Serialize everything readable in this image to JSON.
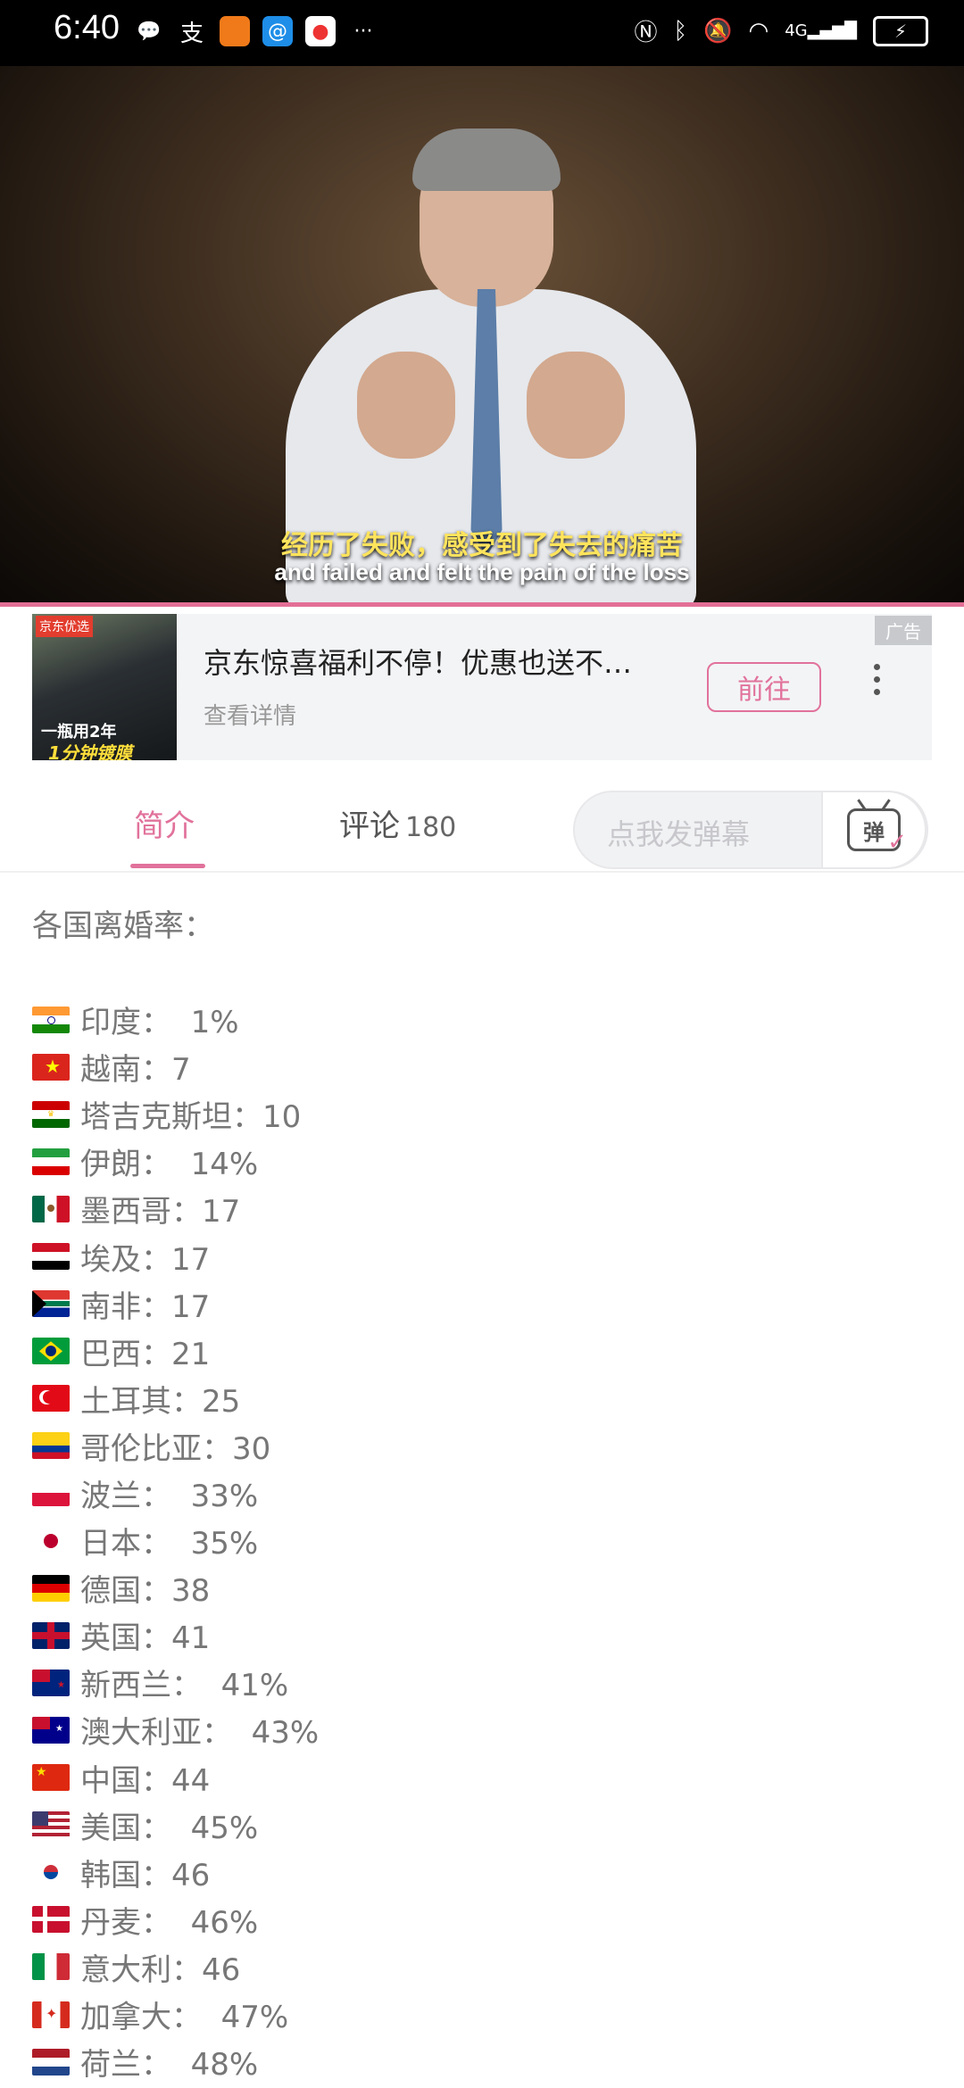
{
  "status_bar": {
    "time": "6:40",
    "left_icons": [
      "chat-bubble-icon",
      "alipay-icon",
      "app-orange-icon",
      "app-blue-icon",
      "app-red-icon",
      "more-dots-icon"
    ],
    "right_icons": [
      "nfc-icon",
      "bluetooth-icon",
      "mute-bell-icon",
      "wifi-icon",
      "signal-4g-icon",
      "battery-charging-icon"
    ],
    "network": "4G"
  },
  "video": {
    "subtitle_cn": "经历了失败，感受到了失去的痛苦",
    "subtitle_en": "and failed and felt the pain of the loss",
    "accent_color": "#e36f96"
  },
  "ad": {
    "thumb_tag": "京东优选",
    "thumb_line1": "一瓶用2年",
    "thumb_line2": "1分钟镀膜",
    "title": "京东惊喜福利不停！优惠也送不…",
    "subtitle": "查看详情",
    "button_label": "前往",
    "tag": "广告"
  },
  "tabs": {
    "intro_label": "简介",
    "comments_label": "评论",
    "comments_count": "180",
    "danmaku_placeholder": "点我发弹幕",
    "danmaku_icon": "弹"
  },
  "description": {
    "heading": "各国离婚率：",
    "rows": [
      {
        "flag": "india",
        "text": "印度：  1%"
      },
      {
        "flag": "vietnam",
        "text": "越南：7"
      },
      {
        "flag": "tajikistan",
        "text": "塔吉克斯坦：10"
      },
      {
        "flag": "iran",
        "text": "伊朗：  14%"
      },
      {
        "flag": "mexico",
        "text": "墨西哥：17"
      },
      {
        "flag": "egypt",
        "text": "埃及：17"
      },
      {
        "flag": "south-africa",
        "text": "南非：17"
      },
      {
        "flag": "brazil",
        "text": "巴西：21"
      },
      {
        "flag": "turkey",
        "text": "土耳其：25"
      },
      {
        "flag": "colombia",
        "text": "哥伦比亚：30"
      },
      {
        "flag": "poland",
        "text": "波兰：  33%"
      },
      {
        "flag": "japan",
        "text": "日本：  35%"
      },
      {
        "flag": "germany",
        "text": "德国：38"
      },
      {
        "flag": "uk",
        "text": "英国：41"
      },
      {
        "flag": "new-zealand",
        "text": "新西兰：  41%"
      },
      {
        "flag": "australia",
        "text": "澳大利亚：  43%"
      },
      {
        "flag": "china",
        "text": "中国：44"
      },
      {
        "flag": "usa",
        "text": "美国：  45%"
      },
      {
        "flag": "south-korea",
        "text": "韩国：46"
      },
      {
        "flag": "denmark",
        "text": "丹麦：  46%"
      },
      {
        "flag": "italy",
        "text": "意大利：46"
      },
      {
        "flag": "canada",
        "text": "加拿大：  47%"
      },
      {
        "flag": "netherlands",
        "text": "荷兰：  48%"
      }
    ]
  }
}
